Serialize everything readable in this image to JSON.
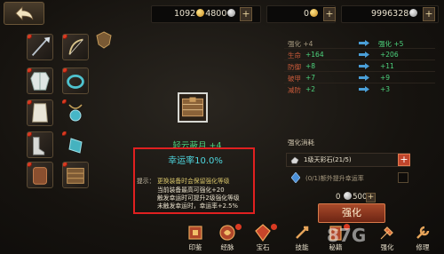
{
  "topbar": {
    "gold_amount": "1092",
    "silver_amount": "4800",
    "currency2": "0",
    "currency3": "9996328",
    "plus_label": "+"
  },
  "equipment": {
    "slot_icons": [
      "polearm-icon",
      "bow-icon",
      "shield-icon",
      "robe-icon",
      "ring-icon",
      "cape-icon",
      "amulet-icon",
      "boots-icon",
      "glove-icon",
      "belt-icon",
      "bracer-icon"
    ]
  },
  "item": {
    "name": "轻云蔽月 +4",
    "luck_rate": "幸运率10.0%"
  },
  "tip": {
    "label": "提示：",
    "lines": [
      "更换装备时会保留强化等级",
      "当前装备最高可强化+20",
      "触发幸运时可提升2级强化等级",
      "未触发幸运时，幸运率+2.5%"
    ]
  },
  "stats": {
    "header_current": "强化 +4",
    "header_next": "强化 +5",
    "rows": [
      {
        "label": "生命",
        "current": "+164",
        "next": "+206"
      },
      {
        "label": "防御",
        "current": "+8",
        "next": "+11"
      },
      {
        "label": "破甲",
        "current": "+7",
        "next": "+9"
      },
      {
        "label": "减防",
        "current": "+2",
        "next": "+3"
      }
    ]
  },
  "consume": {
    "title": "强化消耗",
    "item_text": "1级天彩石(21/5)",
    "luck_text": "(0/1)额外提升幸运率",
    "cost_amount": "5000",
    "cost_prefix": "0",
    "plus_label": "+"
  },
  "strengthen_button": "强化",
  "nav": {
    "items": [
      {
        "label": "印鉴",
        "icon": "seal-icon"
      },
      {
        "label": "经脉",
        "icon": "meridian-icon"
      },
      {
        "label": "宝石",
        "icon": "gem-icon"
      },
      {
        "label": "技能",
        "icon": "skill-icon"
      },
      {
        "label": "秘籍",
        "icon": "book-icon"
      },
      {
        "label": "强化",
        "icon": "strengthen-icon"
      },
      {
        "label": "修理",
        "icon": "repair-icon"
      }
    ]
  },
  "watermark_text": "87G.com",
  "colors": {
    "green": "#4dd37d",
    "cyan": "#4fd7e0",
    "red_frame": "#e02020",
    "stat_label": "#c85a3a"
  }
}
